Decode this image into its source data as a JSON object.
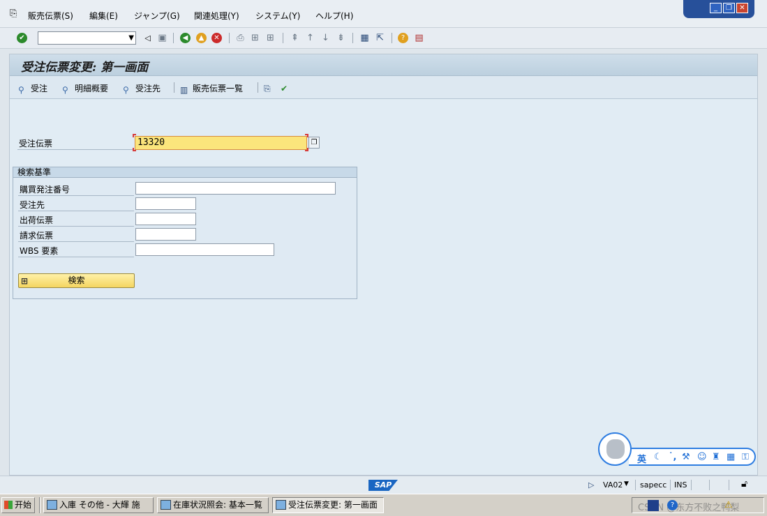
{
  "menu": {
    "items": [
      "販売伝票(S)",
      "編集(E)",
      "ジャンプ(G)",
      "関連処理(Y)",
      "システム(Y)",
      "ヘルプ(H)"
    ]
  },
  "toolbar": {
    "command_value": ""
  },
  "window": {
    "title": "受注伝票変更: 第一画面"
  },
  "app_toolbar": {
    "items": [
      "受注",
      "明細概要",
      "受注先",
      "販売伝票一覧"
    ]
  },
  "form": {
    "doc_label": "受注伝票",
    "doc_value": "13320",
    "group_title": "検索基準",
    "fields": [
      {
        "label": "購買発注番号",
        "value": ""
      },
      {
        "label": "受注先",
        "value": ""
      },
      {
        "label": "出荷伝票",
        "value": ""
      },
      {
        "label": "請求伝票",
        "value": ""
      },
      {
        "label": "WBS 要素",
        "value": ""
      }
    ],
    "search_label": "検索"
  },
  "statusbar": {
    "logo": "SAP",
    "transaction": "VA02",
    "server": "sapecc",
    "mode": "INS"
  },
  "taskbar": {
    "start_label": "开始",
    "tasks": [
      "入庫 その他 - 大輝 施",
      "在庫状況照会: 基本一覧",
      "受注伝票変更: 第一画面"
    ],
    "watermark": "CSDN @东方不败之鸭梨"
  },
  "ime": {
    "lang_label": "英"
  },
  "colors": {
    "accent_yellow": "#fbe57c",
    "title_blue": "#bcd0df",
    "window_blue": "#27509a"
  },
  "icons": {
    "menu": "menu-icon",
    "enter": "check-icon",
    "save": "save-icon",
    "back": "back-icon",
    "exit": "exit-icon",
    "cancel": "cancel-icon",
    "print": "print-icon",
    "find": "find-icon",
    "help": "help-icon",
    "search_button": "binoculars-icon"
  }
}
